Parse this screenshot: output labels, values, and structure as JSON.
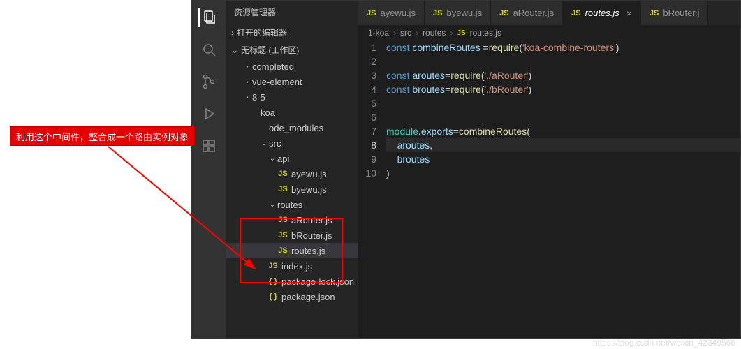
{
  "callout_text": "利用这个中间件，整合成一个路由实例对象",
  "watermark": "https://blog.csdn.net/weixin_42349568",
  "activity": {
    "explorer": "资源管理器"
  },
  "sidebar": {
    "open_editors": "打开的编辑器",
    "workspace": "无标题 (工作区)",
    "items": {
      "completed": "completed",
      "vue_element": "vue-element",
      "eight_five": "8-5",
      "koa": "koa",
      "node_modules": "ode_modules",
      "src": "src",
      "api": "api",
      "ayewu": "ayewu.js",
      "byewu": "byewu.js",
      "routes": "routes",
      "arouter": "aRouter.js",
      "brouter": "bRouter.js",
      "routesjs": "routes.js",
      "indexjs": "index.js",
      "pkglock": "package-lock.json",
      "pkg": "package.json"
    }
  },
  "tabs": {
    "t1": "ayewu.js",
    "t2": "byewu.js",
    "t3": "aRouter.js",
    "t4": "routes.js",
    "t5": "bRouter.j"
  },
  "breadcrumb": {
    "b1": "1-koa",
    "b2": "src",
    "b3": "routes",
    "b4": "routes.js"
  },
  "code": {
    "line_nums": [
      "1",
      "2",
      "3",
      "4",
      "5",
      "6",
      "7",
      "8",
      "9",
      "10"
    ],
    "kw_const": "const",
    "v_combine": "combineRoutes",
    "fn_require": "require",
    "s_pkg": "'koa-combine-routers'",
    "v_aroutes": "aroutes",
    "s_arouter": "'./aRouter'",
    "v_broutes": "broutes",
    "s_brouter": "'./bRouter'",
    "mod": "module",
    "exp": "exports",
    "a2": "aroutes",
    "b2": "broutes",
    "comma": ",",
    "eq": "=",
    "op": "(",
    "cp": ")",
    "dot": "."
  },
  "icons": {
    "js": "JS",
    "json": "{ }",
    "chev_right": "›",
    "chev_down": "⌄",
    "close": "×"
  }
}
